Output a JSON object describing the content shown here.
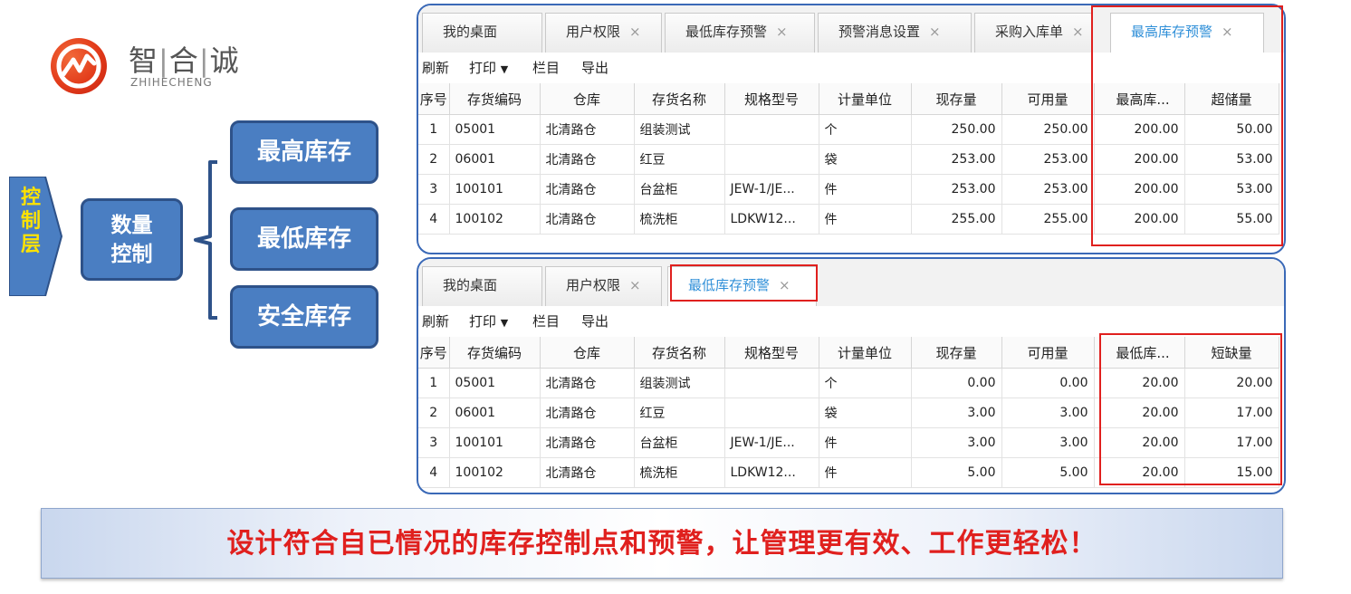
{
  "logo": {
    "name_parts": [
      "智",
      "合",
      "诚"
    ],
    "subtitle": "ZHIHECHENG",
    "mark_color": "#e23b1a"
  },
  "diagram": {
    "layer_label": [
      "控",
      "制",
      "层"
    ],
    "quantity_box": [
      "数量",
      "控制"
    ],
    "items": [
      "最高库存",
      "最低库存",
      "安全库存"
    ]
  },
  "panel_top": {
    "tabs": [
      {
        "label": "我的桌面",
        "closable": false
      },
      {
        "label": "用户权限",
        "closable": true
      },
      {
        "label": "最低库存预警",
        "closable": true
      },
      {
        "label": "预警消息设置",
        "closable": true
      },
      {
        "label": "采购入库单",
        "closable": true
      },
      {
        "label": "最高库存预警",
        "closable": true,
        "active": true
      }
    ],
    "toolbar": {
      "refresh": "刷新",
      "print": "打印",
      "print_caret": "▼",
      "columns": "栏目",
      "export": "导出"
    },
    "headers": [
      "序号",
      "存货编码",
      "仓库",
      "存货名称",
      "规格型号",
      "计量单位",
      "现存量",
      "可用量",
      "最高库...",
      "超储量"
    ],
    "rows": [
      [
        "1",
        "05001",
        "北清路仓",
        "组装测试",
        "",
        "个",
        "250.00",
        "250.00",
        "200.00",
        "50.00"
      ],
      [
        "2",
        "06001",
        "北清路仓",
        "红豆",
        "",
        "袋",
        "253.00",
        "253.00",
        "200.00",
        "53.00"
      ],
      [
        "3",
        "100101",
        "北清路仓",
        "台盆柜",
        "JEW-1/JE...",
        "件",
        "253.00",
        "253.00",
        "200.00",
        "53.00"
      ],
      [
        "4",
        "100102",
        "北清路仓",
        "梳洗柜",
        "LDKW12...",
        "件",
        "255.00",
        "255.00",
        "200.00",
        "55.00"
      ]
    ]
  },
  "panel_bottom": {
    "tabs": [
      {
        "label": "我的桌面",
        "closable": false
      },
      {
        "label": "用户权限",
        "closable": true
      },
      {
        "label": "最低库存预警",
        "closable": true,
        "active": true
      }
    ],
    "toolbar": {
      "refresh": "刷新",
      "print": "打印",
      "print_caret": "▼",
      "columns": "栏目",
      "export": "导出"
    },
    "headers": [
      "序号",
      "存货编码",
      "仓库",
      "存货名称",
      "规格型号",
      "计量单位",
      "现存量",
      "可用量",
      "最低库...",
      "短缺量"
    ],
    "rows": [
      [
        "1",
        "05001",
        "北清路仓",
        "组装测试",
        "",
        "个",
        "0.00",
        "0.00",
        "20.00",
        "20.00"
      ],
      [
        "2",
        "06001",
        "北清路仓",
        "红豆",
        "",
        "袋",
        "3.00",
        "3.00",
        "20.00",
        "17.00"
      ],
      [
        "3",
        "100101",
        "北清路仓",
        "台盆柜",
        "JEW-1/JE...",
        "件",
        "3.00",
        "3.00",
        "20.00",
        "17.00"
      ],
      [
        "4",
        "100102",
        "北清路仓",
        "梳洗柜",
        "LDKW12...",
        "件",
        "5.00",
        "5.00",
        "20.00",
        "15.00"
      ]
    ]
  },
  "tab_close_glyph": "×",
  "banner": "设计符合自已情况的库存控制点和预警，让管理更有效、工作更轻松！",
  "colors": {
    "box_blue": "#4a7ec2",
    "panel_border": "#3a69b7",
    "highlight_red": "#e0201e",
    "active_tab": "#2f8fd8",
    "layer_yellow": "#ffe300"
  }
}
